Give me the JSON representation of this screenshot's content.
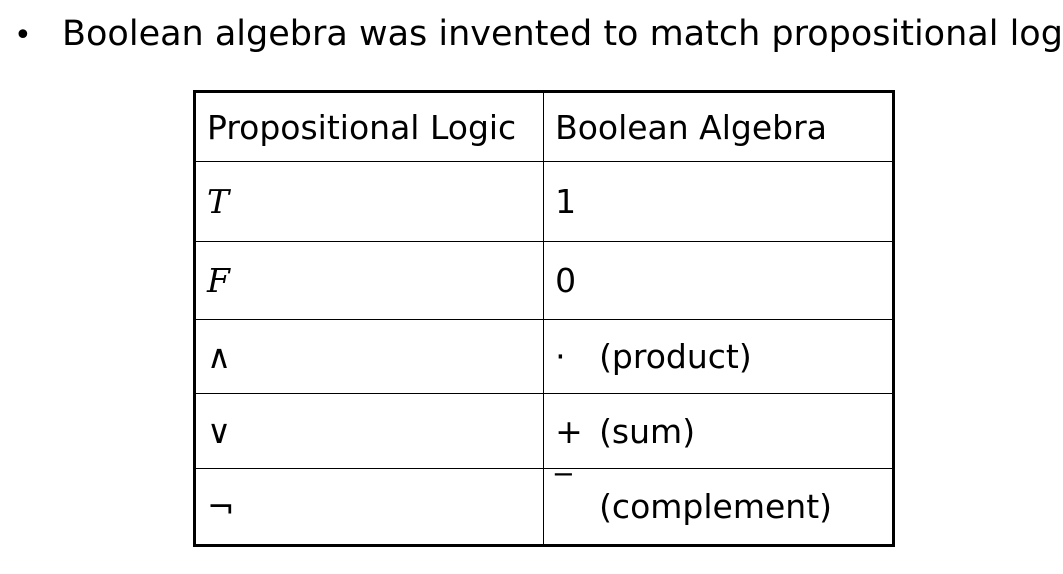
{
  "slide": {
    "bullet_symbol": "•",
    "bullet_text": "Boolean algebra was invented to match propositional logic."
  },
  "table": {
    "headers": [
      "Propositional Logic",
      "Boolean Algebra"
    ],
    "rows": [
      {
        "logic": "T",
        "boolean_symbol": "1",
        "boolean_note": ""
      },
      {
        "logic": "F",
        "boolean_symbol": "0",
        "boolean_note": ""
      },
      {
        "logic": "∧",
        "boolean_symbol": "·",
        "boolean_note": "(product)"
      },
      {
        "logic": "∨",
        "boolean_symbol": "+",
        "boolean_note": "(sum)"
      },
      {
        "logic": "¬",
        "boolean_symbol": "‾",
        "boolean_note": "(complement)"
      }
    ]
  }
}
